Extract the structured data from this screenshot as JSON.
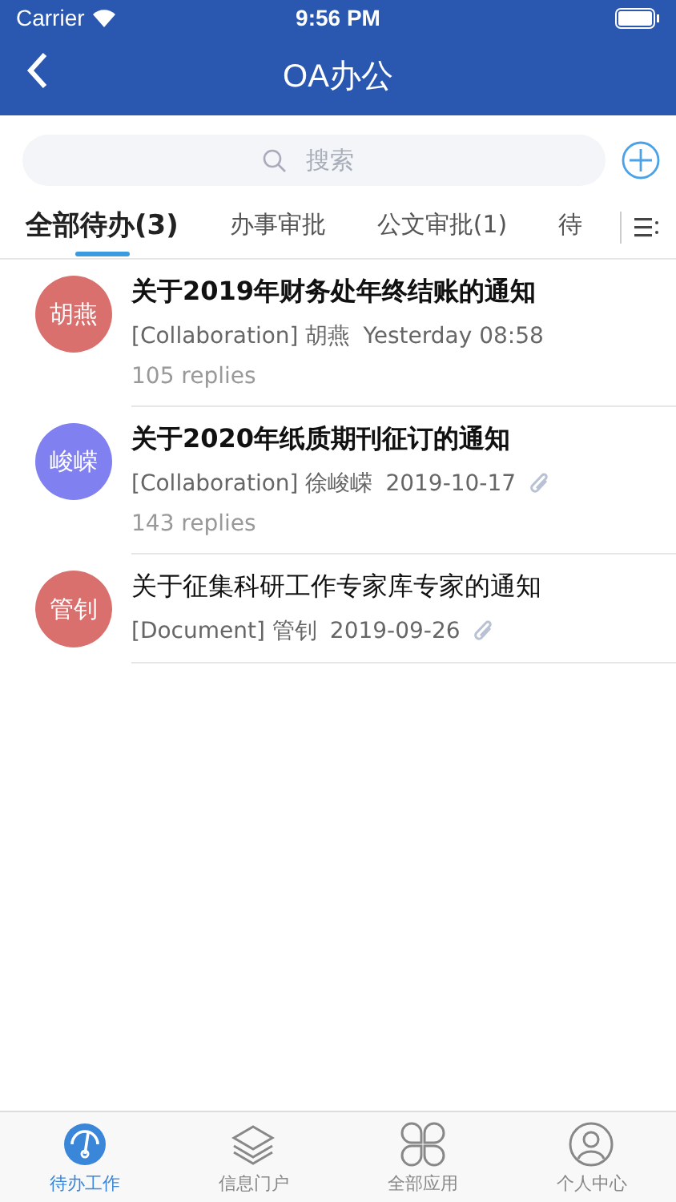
{
  "status_bar": {
    "carrier": "Carrier",
    "time": "9:56 PM"
  },
  "nav": {
    "title": "OA办公"
  },
  "search": {
    "placeholder": "搜索"
  },
  "tabs": [
    {
      "label": "全部待办(3)",
      "selected": true
    },
    {
      "label": "办事审批",
      "selected": false
    },
    {
      "label": "公文审批(1)",
      "selected": false
    },
    {
      "label": "待",
      "selected": false
    }
  ],
  "items": [
    {
      "avatar": "胡燕",
      "color": "#d9706e",
      "title": "关于2019年财务处年终结账的通知",
      "unread": true,
      "meta": "[Collaboration] 胡燕",
      "date": "Yesterday 08:58",
      "attachment": false,
      "replies": "105 replies"
    },
    {
      "avatar": "峻嵘",
      "color": "#8080f0",
      "title": "关于2020年纸质期刊征订的通知",
      "unread": true,
      "meta": "[Collaboration] 徐峻嵘",
      "date": "2019-10-17",
      "attachment": true,
      "replies": "143 replies"
    },
    {
      "avatar": "管钊",
      "color": "#d9706e",
      "title": "关于征集科研工作专家库专家的通知",
      "unread": false,
      "meta": "[Document] 管钊",
      "date": "2019-09-26",
      "attachment": true
    }
  ],
  "bottom_tabs": [
    {
      "label": "待办工作",
      "kind": "gauge",
      "selected": true
    },
    {
      "label": "信息门户",
      "kind": "layers",
      "selected": false
    },
    {
      "label": "全部应用",
      "kind": "clover",
      "selected": false
    },
    {
      "label": "个人中心",
      "kind": "user",
      "selected": false
    }
  ]
}
